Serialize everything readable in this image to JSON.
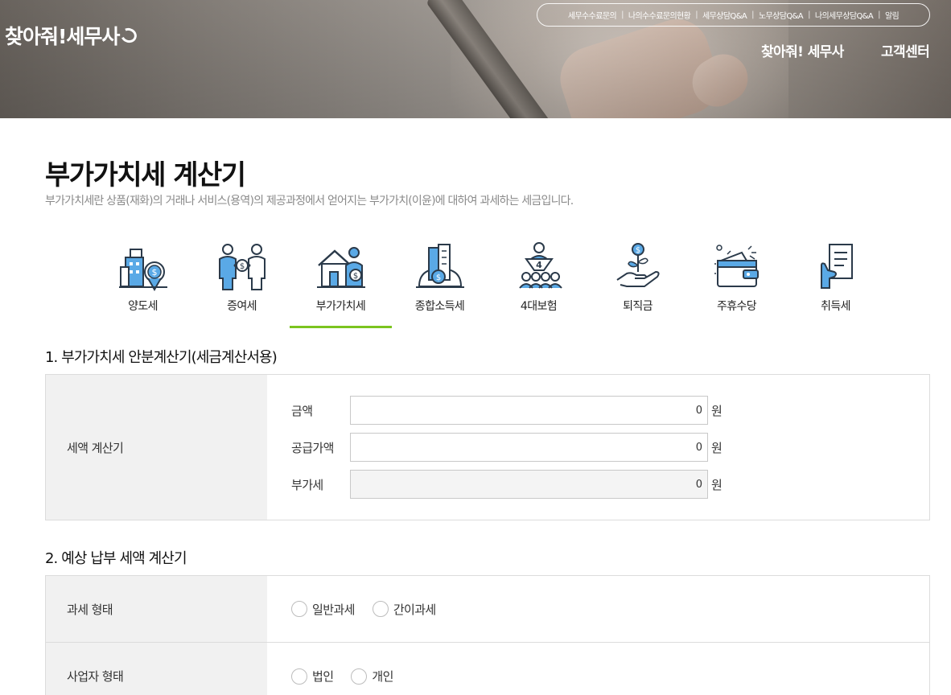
{
  "header": {
    "logo_text": "찾아줘!세무사",
    "utility_links": [
      "세무수수료문의",
      "나의수수료문의현황",
      "세무상담Q&A",
      "노무상담Q&A",
      "나의세무상담Q&A",
      "알림"
    ],
    "nav": [
      "찾아줘! 세무사",
      "고객센터"
    ]
  },
  "page": {
    "title": "부가가치세 계산기",
    "description": "부가가치세란 상품(재화)의 거래나 서비스(용역)의 제공과정에서 얻어지는 부가가치(이윤)에 대하여 과세하는 세금입니다."
  },
  "tabs": [
    {
      "label": "양도세",
      "icon": "building-coin-icon"
    },
    {
      "label": "증여세",
      "icon": "people-exchange-icon"
    },
    {
      "label": "부가가치세",
      "icon": "house-person-icon",
      "active": true
    },
    {
      "label": "종합소득세",
      "icon": "city-globe-icon"
    },
    {
      "label": "4대보험",
      "icon": "group-four-icon"
    },
    {
      "label": "퇴직금",
      "icon": "hand-plant-coin-icon"
    },
    {
      "label": "주휴수당",
      "icon": "wallet-icon"
    },
    {
      "label": "취득세",
      "icon": "document-hand-icon"
    }
  ],
  "section1": {
    "title": "1. 부가가치세 안분계산기(세금계산서용)",
    "row_label": "세액 계산기",
    "fields": [
      {
        "label": "금액",
        "value": "0",
        "unit": "원"
      },
      {
        "label": "공급가액",
        "value": "0",
        "unit": "원"
      },
      {
        "label": "부가세",
        "value": "0",
        "unit": "원"
      }
    ]
  },
  "section2": {
    "title": "2. 예상 납부 세액 계산기",
    "rows": [
      {
        "label": "과세 형태",
        "options": [
          "일반과세",
          "간이과세"
        ]
      },
      {
        "label": "사업자 형태",
        "options": [
          "법인",
          "개인"
        ]
      }
    ]
  },
  "colors": {
    "accent": "#7bc41f",
    "icon_blue": "#5aa9e6",
    "icon_dark": "#2b3a4a"
  }
}
